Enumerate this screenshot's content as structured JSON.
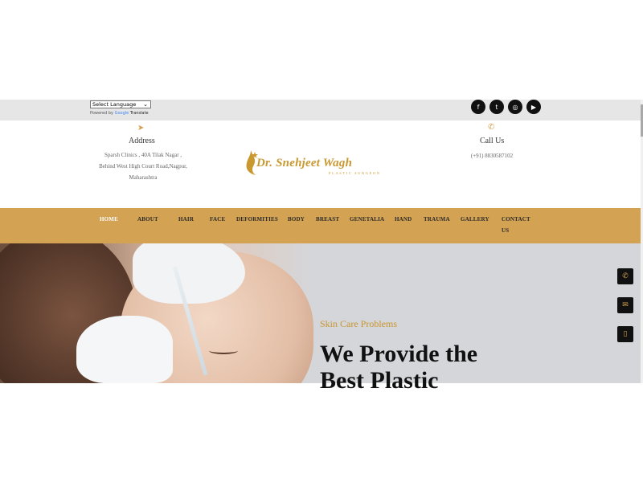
{
  "translate": {
    "select_label": "Select Language",
    "powered_prefix": "Powered by",
    "google": "Google",
    "translate_word": "Translate"
  },
  "social": [
    {
      "name": "facebook-icon",
      "glyph": "f"
    },
    {
      "name": "twitter-icon",
      "glyph": "t"
    },
    {
      "name": "instagram-icon",
      "glyph": "◎"
    },
    {
      "name": "youtube-icon",
      "glyph": "▶"
    }
  ],
  "address": {
    "title": "Address",
    "line1": "Sparsh Clinics , 40A Tilak Nagar ,",
    "line2": "Behind West High Court Road,Nagpur,",
    "line3": "Maharashtra"
  },
  "logo": {
    "name": "Dr. Snehjeet Wagh",
    "subtitle": "PLASTIC SURGEON"
  },
  "call": {
    "title": "Call Us",
    "phone": "(+91) 8830587102"
  },
  "nav": {
    "items": [
      "HOME",
      "ABOUT",
      "HAIR",
      "FACE",
      "DEFORMITIES",
      "BODY",
      "BREAST",
      "GENETALIA",
      "HAND",
      "TRAUMA",
      "GALLERY",
      "CONTACT",
      "US"
    ],
    "active": "HOME"
  },
  "hero": {
    "subtitle": "Skin Care Problems",
    "title_line1": "We Provide the",
    "title_line2": "Best Plastic"
  },
  "colors": {
    "accent": "#d3a252",
    "gold_text": "#c8952f",
    "dark": "#111111"
  }
}
